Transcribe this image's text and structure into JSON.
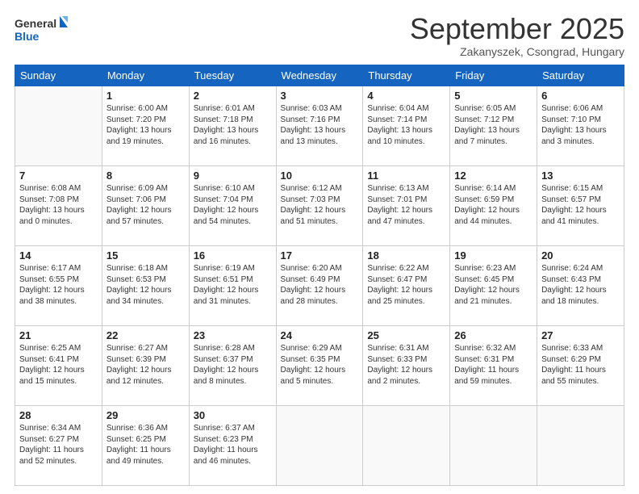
{
  "header": {
    "logo_line1": "General",
    "logo_line2": "Blue",
    "month": "September 2025",
    "location": "Zakanyszek, Csongrad, Hungary"
  },
  "days_of_week": [
    "Sunday",
    "Monday",
    "Tuesday",
    "Wednesday",
    "Thursday",
    "Friday",
    "Saturday"
  ],
  "weeks": [
    [
      {
        "day": "",
        "info": ""
      },
      {
        "day": "1",
        "info": "Sunrise: 6:00 AM\nSunset: 7:20 PM\nDaylight: 13 hours\nand 19 minutes."
      },
      {
        "day": "2",
        "info": "Sunrise: 6:01 AM\nSunset: 7:18 PM\nDaylight: 13 hours\nand 16 minutes."
      },
      {
        "day": "3",
        "info": "Sunrise: 6:03 AM\nSunset: 7:16 PM\nDaylight: 13 hours\nand 13 minutes."
      },
      {
        "day": "4",
        "info": "Sunrise: 6:04 AM\nSunset: 7:14 PM\nDaylight: 13 hours\nand 10 minutes."
      },
      {
        "day": "5",
        "info": "Sunrise: 6:05 AM\nSunset: 7:12 PM\nDaylight: 13 hours\nand 7 minutes."
      },
      {
        "day": "6",
        "info": "Sunrise: 6:06 AM\nSunset: 7:10 PM\nDaylight: 13 hours\nand 3 minutes."
      }
    ],
    [
      {
        "day": "7",
        "info": "Sunrise: 6:08 AM\nSunset: 7:08 PM\nDaylight: 13 hours\nand 0 minutes."
      },
      {
        "day": "8",
        "info": "Sunrise: 6:09 AM\nSunset: 7:06 PM\nDaylight: 12 hours\nand 57 minutes."
      },
      {
        "day": "9",
        "info": "Sunrise: 6:10 AM\nSunset: 7:04 PM\nDaylight: 12 hours\nand 54 minutes."
      },
      {
        "day": "10",
        "info": "Sunrise: 6:12 AM\nSunset: 7:03 PM\nDaylight: 12 hours\nand 51 minutes."
      },
      {
        "day": "11",
        "info": "Sunrise: 6:13 AM\nSunset: 7:01 PM\nDaylight: 12 hours\nand 47 minutes."
      },
      {
        "day": "12",
        "info": "Sunrise: 6:14 AM\nSunset: 6:59 PM\nDaylight: 12 hours\nand 44 minutes."
      },
      {
        "day": "13",
        "info": "Sunrise: 6:15 AM\nSunset: 6:57 PM\nDaylight: 12 hours\nand 41 minutes."
      }
    ],
    [
      {
        "day": "14",
        "info": "Sunrise: 6:17 AM\nSunset: 6:55 PM\nDaylight: 12 hours\nand 38 minutes."
      },
      {
        "day": "15",
        "info": "Sunrise: 6:18 AM\nSunset: 6:53 PM\nDaylight: 12 hours\nand 34 minutes."
      },
      {
        "day": "16",
        "info": "Sunrise: 6:19 AM\nSunset: 6:51 PM\nDaylight: 12 hours\nand 31 minutes."
      },
      {
        "day": "17",
        "info": "Sunrise: 6:20 AM\nSunset: 6:49 PM\nDaylight: 12 hours\nand 28 minutes."
      },
      {
        "day": "18",
        "info": "Sunrise: 6:22 AM\nSunset: 6:47 PM\nDaylight: 12 hours\nand 25 minutes."
      },
      {
        "day": "19",
        "info": "Sunrise: 6:23 AM\nSunset: 6:45 PM\nDaylight: 12 hours\nand 21 minutes."
      },
      {
        "day": "20",
        "info": "Sunrise: 6:24 AM\nSunset: 6:43 PM\nDaylight: 12 hours\nand 18 minutes."
      }
    ],
    [
      {
        "day": "21",
        "info": "Sunrise: 6:25 AM\nSunset: 6:41 PM\nDaylight: 12 hours\nand 15 minutes."
      },
      {
        "day": "22",
        "info": "Sunrise: 6:27 AM\nSunset: 6:39 PM\nDaylight: 12 hours\nand 12 minutes."
      },
      {
        "day": "23",
        "info": "Sunrise: 6:28 AM\nSunset: 6:37 PM\nDaylight: 12 hours\nand 8 minutes."
      },
      {
        "day": "24",
        "info": "Sunrise: 6:29 AM\nSunset: 6:35 PM\nDaylight: 12 hours\nand 5 minutes."
      },
      {
        "day": "25",
        "info": "Sunrise: 6:31 AM\nSunset: 6:33 PM\nDaylight: 12 hours\nand 2 minutes."
      },
      {
        "day": "26",
        "info": "Sunrise: 6:32 AM\nSunset: 6:31 PM\nDaylight: 11 hours\nand 59 minutes."
      },
      {
        "day": "27",
        "info": "Sunrise: 6:33 AM\nSunset: 6:29 PM\nDaylight: 11 hours\nand 55 minutes."
      }
    ],
    [
      {
        "day": "28",
        "info": "Sunrise: 6:34 AM\nSunset: 6:27 PM\nDaylight: 11 hours\nand 52 minutes."
      },
      {
        "day": "29",
        "info": "Sunrise: 6:36 AM\nSunset: 6:25 PM\nDaylight: 11 hours\nand 49 minutes."
      },
      {
        "day": "30",
        "info": "Sunrise: 6:37 AM\nSunset: 6:23 PM\nDaylight: 11 hours\nand 46 minutes."
      },
      {
        "day": "",
        "info": ""
      },
      {
        "day": "",
        "info": ""
      },
      {
        "day": "",
        "info": ""
      },
      {
        "day": "",
        "info": ""
      }
    ]
  ]
}
